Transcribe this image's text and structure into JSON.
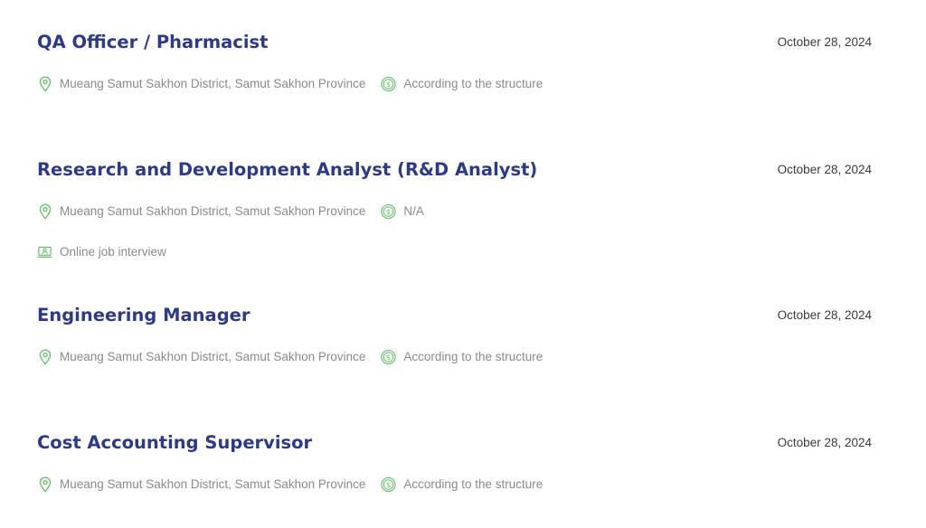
{
  "colors": {
    "title": "#2e3a87",
    "date": "#3a3a3a",
    "meta_text": "#8a8a8a",
    "icon": "#6cc070"
  },
  "jobs": [
    {
      "title": "QA Officer / Pharmacist",
      "date": "October 28, 2024",
      "location": "Mueang Samut Sakhon District, Samut Sakhon Province",
      "location_icon": "map-pin-icon",
      "salary": "According to the structure",
      "salary_icon": "dollar-coin-icon"
    },
    {
      "title": "Research and Development Analyst (R&D Analyst)",
      "date": "October 28, 2024",
      "location": "Mueang Samut Sakhon District, Samut Sakhon Province",
      "location_icon": "map-pin-icon",
      "salary": "N/A",
      "salary_icon": "dollar-coin-icon",
      "interview": "Online job interview",
      "interview_icon": "laptop-user-icon"
    },
    {
      "title": "Engineering Manager",
      "date": "October 28, 2024",
      "location": "Mueang Samut Sakhon District, Samut Sakhon Province",
      "location_icon": "map-pin-icon",
      "salary": "According to the structure",
      "salary_icon": "dollar-coin-icon"
    },
    {
      "title": "Cost Accounting Supervisor",
      "date": "October 28, 2024",
      "location": "Mueang Samut Sakhon District, Samut Sakhon Province",
      "location_icon": "map-pin-icon",
      "salary": "According to the structure",
      "salary_icon": "dollar-coin-icon"
    }
  ]
}
